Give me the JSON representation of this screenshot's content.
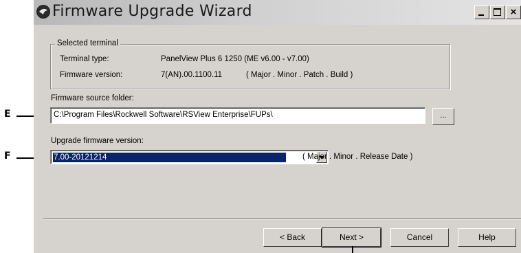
{
  "window": {
    "title": "Firmware Upgrade Wizard",
    "controls": {
      "minimize": "_",
      "maximize": "□",
      "close": "×"
    }
  },
  "selected_terminal": {
    "legend": "Selected terminal",
    "terminal_type_label": "Terminal type:",
    "terminal_type_value": "PanelView Plus 6  1250  (ME v6.00 - v7.00)",
    "firmware_version_label": "Firmware version:",
    "firmware_version_value": "7(AN).00.1100.11",
    "firmware_version_format": "( Major . Minor . Patch . Build )"
  },
  "source": {
    "label": "Firmware source folder:",
    "path": "C:\\Program Files\\Rockwell Software\\RSView Enterprise\\FUPs\\",
    "browse_label": "..."
  },
  "upgrade": {
    "label": "Upgrade firmware version:",
    "selected": "7.00-20121214",
    "format": "( Major . Minor . Release Date )"
  },
  "buttons": {
    "back": "< Back",
    "next": "Next >",
    "cancel": "Cancel",
    "help": "Help"
  },
  "callouts": {
    "e": "E",
    "f": "F"
  }
}
